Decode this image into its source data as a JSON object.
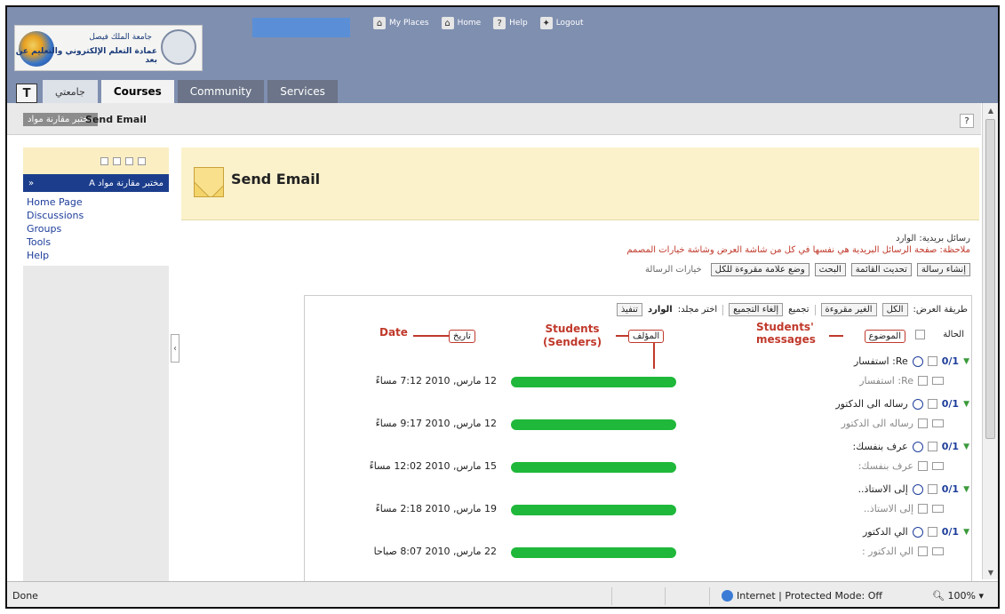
{
  "header": {
    "logo_line1": "جامعة الملك فيصل",
    "logo_line2": "عمادة التعلم الإلكتروني والتعليم عن بعد",
    "top_links": [
      {
        "label": "My Places",
        "icon": "places-icon"
      },
      {
        "label": "Home",
        "icon": "home-icon"
      },
      {
        "label": "Help",
        "icon": "help-icon"
      },
      {
        "label": "Logout",
        "icon": "logout-icon"
      }
    ],
    "tabs": [
      "جامعتي",
      "Courses",
      "Community",
      "Services"
    ],
    "tab_box": "T"
  },
  "breadcrumb": {
    "course": "مختبر مقارنة مواد",
    "page": "Send Email",
    "help": "?"
  },
  "sidebar": {
    "title": "مختبر مقارنة مواد A",
    "collapse": "»",
    "links": [
      "Home Page",
      "Discussions",
      "Groups",
      "Tools",
      "Help"
    ]
  },
  "main": {
    "title": "Send Email",
    "inbox_label": "رسائل بريدية: الوارد",
    "note": "ملاحظة: صفحة الرسائل البريدية هي نفسها في كل من شاشة العرض وشاشة خيارات المصمم",
    "buttons": [
      "إنشاء رسالة",
      "تحديث القائمة",
      "البحث",
      "وضع علامة مقروءة للكل",
      "خيارات الرسالة"
    ],
    "toolbar": {
      "view_label": "طريقة العرض:",
      "all": "الكل",
      "unread": "الغير مقروءة",
      "group": "تجميع",
      "ungroup": "إلغاء التجميع",
      "folder_label": "اختر مجلد:",
      "folder_value": "الوارد",
      "execute": "تنفيذ"
    },
    "columns": {
      "status": "الحالة",
      "subject": "الموضوع",
      "author": "المؤلف",
      "date": "تاريخ"
    },
    "annotations": {
      "date": "Date",
      "senders": "Students\n(Senders)",
      "messages": "Students'\nmessages"
    },
    "rows": [
      {
        "count": "0/1",
        "subject": "Re: استفسار",
        "sub_reply": "Re: استفسار",
        "date": "12 مارس, 2010 7:12 مساءً"
      },
      {
        "count": "0/1",
        "subject": "رساله الى الدكتور",
        "sub_reply": "رساله الى الدكتور",
        "date": "12 مارس, 2010 9:17 مساءً"
      },
      {
        "count": "0/1",
        "subject": "عرف بنفسك:",
        "sub_reply": "عرف بنفسك:",
        "date": "15 مارس, 2010 12:02 مساءً"
      },
      {
        "count": "0/1",
        "subject": "إلى الاستاذ..",
        "sub_reply": "إلى الاستاذ..",
        "date": "19 مارس, 2010 2:18 مساءً"
      },
      {
        "count": "0/1",
        "subject": "الي الدكتور",
        "sub_reply": "الي الدكتور :",
        "date": "22 مارس, 2010 8:07 صباحا"
      }
    ]
  },
  "statusbar": {
    "left": "Done",
    "zone": "Internet | Protected Mode: Off",
    "zoom": "100%"
  }
}
